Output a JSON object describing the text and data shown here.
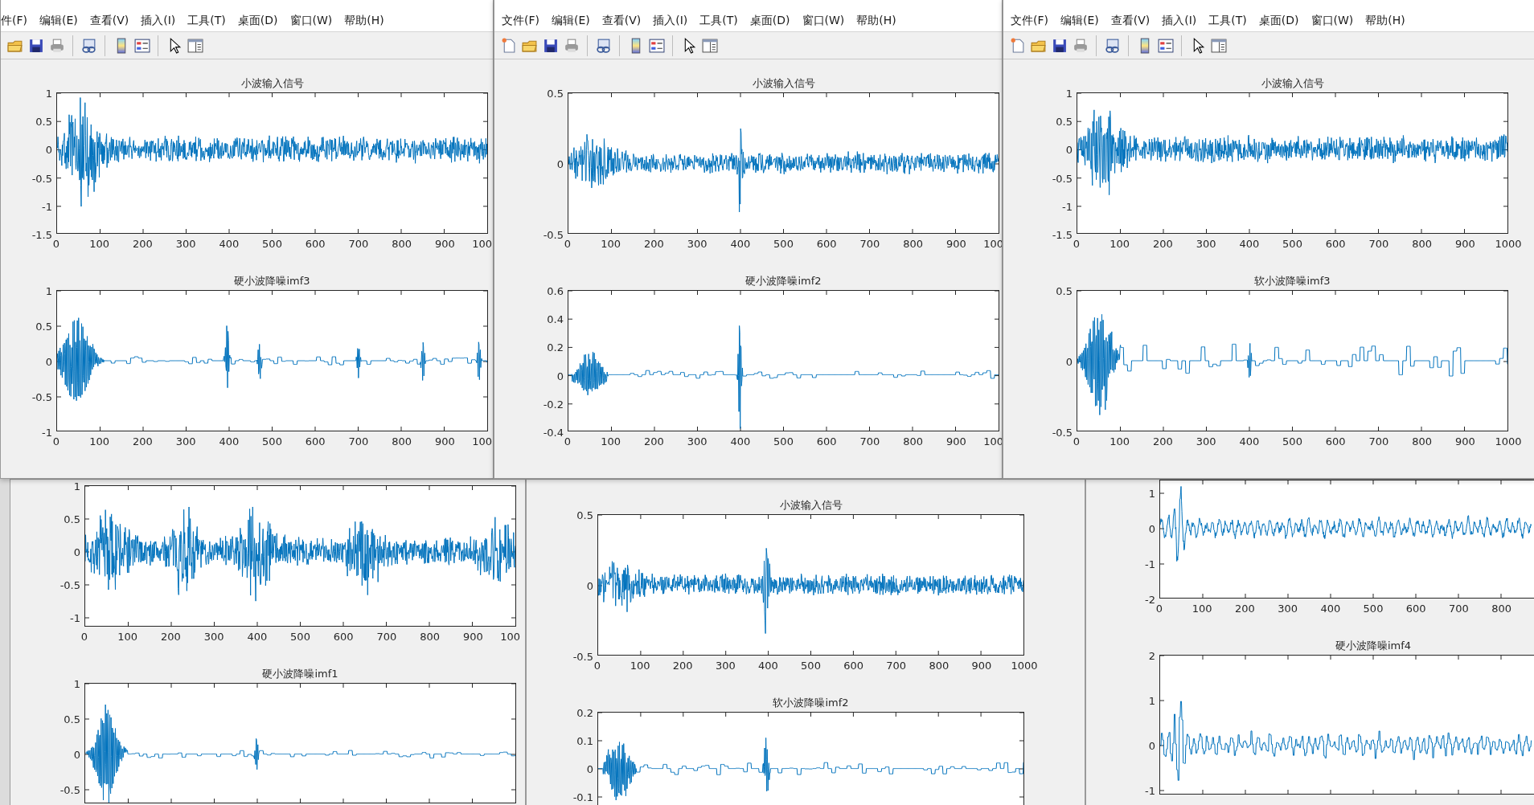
{
  "windows": [
    {
      "menu": [
        "件(F)",
        "编辑(E)",
        "查看(V)",
        "插入(I)",
        "工具(T)",
        "桌面(D)",
        "窗口(W)",
        "帮助(H)"
      ],
      "axes": [
        {
          "title": "小波输入信号",
          "yticks": [
            "1",
            "0.5",
            "0",
            "-0.5",
            "-1",
            "-1.5"
          ],
          "xticks": [
            "0",
            "100",
            "200",
            "300",
            "400",
            "500",
            "600",
            "700",
            "800",
            "900",
            "100"
          ]
        },
        {
          "title": "硬小波降噪imf3",
          "yticks": [
            "1",
            "0.5",
            "0",
            "-0.5",
            "-1"
          ],
          "xticks": [
            "0",
            "100",
            "200",
            "300",
            "400",
            "500",
            "600",
            "700",
            "800",
            "900",
            "100"
          ]
        }
      ]
    },
    {
      "menu": [
        "文件(F)",
        "编辑(E)",
        "查看(V)",
        "插入(I)",
        "工具(T)",
        "桌面(D)",
        "窗口(W)",
        "帮助(H)"
      ],
      "axes": [
        {
          "title": "小波输入信号",
          "yticks": [
            "0.5",
            "0",
            "-0.5"
          ],
          "xticks": [
            "0",
            "100",
            "200",
            "300",
            "400",
            "500",
            "600",
            "700",
            "800",
            "900",
            "100"
          ]
        },
        {
          "title": "硬小波降噪imf2",
          "yticks": [
            "0.6",
            "0.4",
            "0.2",
            "0",
            "-0.2",
            "-0.4"
          ],
          "xticks": [
            "0",
            "100",
            "200",
            "300",
            "400",
            "500",
            "600",
            "700",
            "800",
            "900",
            "100"
          ]
        }
      ]
    },
    {
      "menu": [
        "文件(F)",
        "编辑(E)",
        "查看(V)",
        "插入(I)",
        "工具(T)",
        "桌面(D)",
        "窗口(W)",
        "帮助(H)"
      ],
      "axes": [
        {
          "title": "小波输入信号",
          "yticks": [
            "1",
            "0.5",
            "0",
            "-0.5",
            "-1",
            "-1.5"
          ],
          "xticks": [
            "0",
            "100",
            "200",
            "300",
            "400",
            "500",
            "600",
            "700",
            "800",
            "900",
            "1000"
          ]
        },
        {
          "title": "软小波降噪imf3",
          "yticks": [
            "0.5",
            "0",
            "-0.5"
          ],
          "xticks": [
            "0",
            "100",
            "200",
            "300",
            "400",
            "500",
            "600",
            "700",
            "800",
            "900",
            "1000"
          ]
        }
      ]
    },
    {
      "axes": [
        {
          "yticks": [
            "1",
            "0.5",
            "0",
            "-0.5",
            "-1"
          ],
          "xticks": [
            "0",
            "100",
            "200",
            "300",
            "400",
            "500",
            "600",
            "700",
            "800",
            "900",
            "100"
          ]
        },
        {
          "title": "硬小波降噪imf1",
          "yticks": [
            "1",
            "0.5",
            "0",
            "-0.5"
          ]
        }
      ]
    },
    {
      "axes": [
        {
          "title": "小波输入信号",
          "yticks": [
            "0.5",
            "0",
            "-0.5"
          ],
          "xticks": [
            "0",
            "100",
            "200",
            "300",
            "400",
            "500",
            "600",
            "700",
            "800",
            "900",
            "1000"
          ]
        },
        {
          "title": "软小波降噪imf2",
          "yticks": [
            "0.2",
            "0.1",
            "0",
            "-0.1"
          ]
        }
      ]
    },
    {
      "axes": [
        {
          "yticks": [
            "1",
            "0",
            "-1",
            "-2"
          ],
          "xticks": [
            "0",
            "100",
            "200",
            "300",
            "400",
            "500",
            "600",
            "700",
            "800"
          ]
        },
        {
          "title": "硬小波降噪imf4",
          "yticks": [
            "2",
            "1",
            "0",
            "-1"
          ]
        }
      ]
    }
  ]
}
